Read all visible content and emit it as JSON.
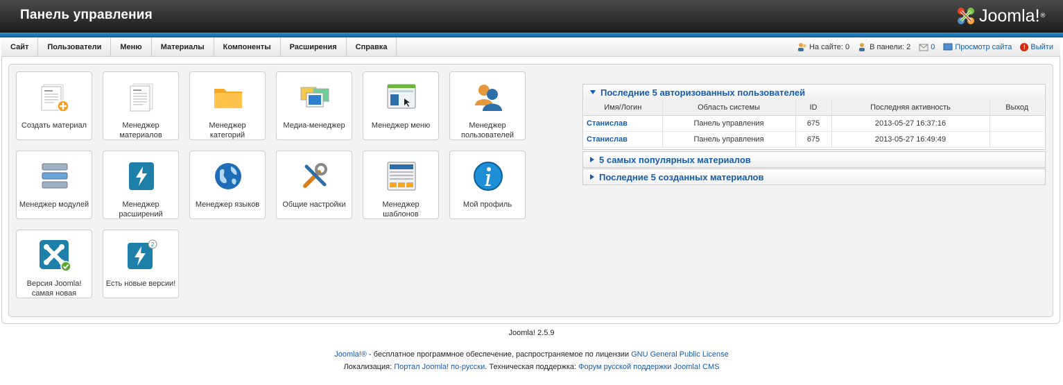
{
  "header": {
    "title": "Панель управления",
    "logo_text": "Joomla!",
    "logo_reg": "®"
  },
  "menu": [
    "Сайт",
    "Пользователи",
    "Меню",
    "Материалы",
    "Компоненты",
    "Расширения",
    "Справка"
  ],
  "status": {
    "on_site": "На сайте: 0",
    "in_panel": "В панели: 2",
    "messages": "0",
    "view_site": "Просмотр сайта",
    "logout": "Выйти"
  },
  "quickicons": [
    {
      "label": "Создать материал",
      "icon": "article-add-icon"
    },
    {
      "label": "Менеджер материалов",
      "icon": "article-icon"
    },
    {
      "label": "Менеджер категорий",
      "icon": "folder-icon"
    },
    {
      "label": "Медиа-менеджер",
      "icon": "media-icon"
    },
    {
      "label": "Менеджер меню",
      "icon": "menu-icon"
    },
    {
      "label": "Менеджер пользователей",
      "icon": "users-icon"
    },
    {
      "label": "Менеджер модулей",
      "icon": "modules-icon"
    },
    {
      "label": "Менеджер расширений",
      "icon": "extensions-icon"
    },
    {
      "label": "Менеджер языков",
      "icon": "language-icon"
    },
    {
      "label": "Общие настройки",
      "icon": "config-icon"
    },
    {
      "label": "Менеджер шаблонов",
      "icon": "themes-icon"
    },
    {
      "label": "Мой профиль",
      "icon": "info-icon"
    },
    {
      "label": "Версия Joomla! самая новая",
      "icon": "joomla-uptodate-icon"
    },
    {
      "label": "Есть новые версии!",
      "icon": "extensions-update-icon"
    }
  ],
  "logged_panel": {
    "title": "Последние 5 авторизованных пользователей",
    "columns": [
      "Имя/Логин",
      "Область системы",
      "ID",
      "Последняя активность",
      "Выход"
    ],
    "rows": [
      [
        "Станислав",
        "Панель управления",
        "675",
        "2013-05-27 16:37:16",
        ""
      ],
      [
        "Станислав",
        "Панель управления",
        "675",
        "2013-05-27 16:49:49",
        ""
      ]
    ]
  },
  "popular_panel": {
    "title": "5 самых популярных материалов"
  },
  "latest_panel": {
    "title": "Последние 5 созданных материалов"
  },
  "footer": {
    "version": "Joomla! 2.5.9",
    "line1_link1": "Joomla!®",
    "line1_text": " - бесплатное программное обеспечение, распространяемое по лицензии ",
    "line1_link2": "GNU General Public License",
    "line2_text1": "Локализация: ",
    "line2_link1": "Портал Joomla! по-русски",
    "line2_text2": ". Техническая поддержка: ",
    "line2_link2": "Форум русской поддержки Joomla! CMS"
  }
}
